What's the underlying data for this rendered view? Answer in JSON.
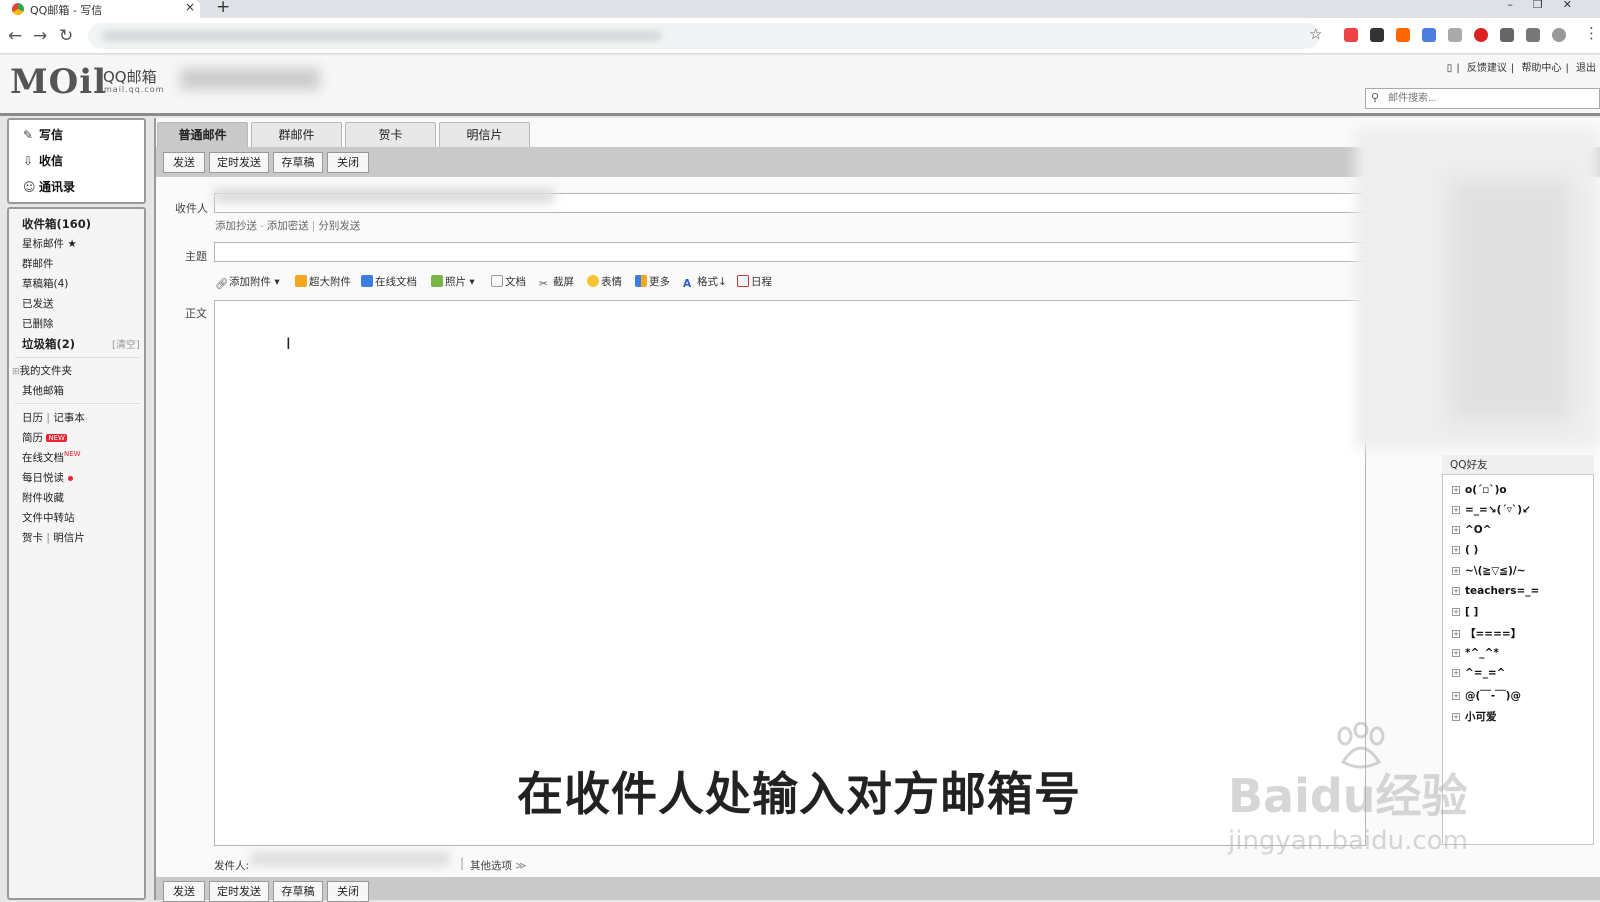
{
  "browser": {
    "tab_title": "QQ邮箱 - 写信",
    "tab_close": "×",
    "new_tab": "+",
    "window_controls": "–❐✕"
  },
  "header": {
    "logo_mail": "MOil",
    "logo_qq": "QQ邮箱",
    "logo_domain": "mail.qq.com",
    "links": [
      "反馈建议",
      "帮助中心",
      "退出"
    ],
    "search_placeholder": "邮件搜索..."
  },
  "nav_top": [
    {
      "label": "写信",
      "icon": "pen-icon"
    },
    {
      "label": "收信",
      "icon": "inbox-icon"
    },
    {
      "label": "通讯录",
      "icon": "contacts-icon"
    }
  ],
  "nav": {
    "inbox": "收件箱(160)",
    "starred": "星标邮件",
    "group": "群邮件",
    "drafts": "草稿箱(4)",
    "sent": "已发送",
    "deleted": "已删除",
    "spam": "垃圾箱(2)",
    "spam_clear": "[清空]",
    "my_folders": "我的文件夹",
    "other_mailbox": "其他邮箱",
    "calendar": "日历",
    "notes": "记事本",
    "resume": "简历",
    "resume_badge": "NEW",
    "online_docs": "在线文档",
    "online_docs_badge": "NEW",
    "daily_read": "每日悦读",
    "attachments": "附件收藏",
    "file_transfer": "文件中转站",
    "cards": "贺卡",
    "postcards": "明信片",
    "divider": "|"
  },
  "compose": {
    "tabs": [
      "普通邮件",
      "群邮件",
      "贺卡",
      "明信片"
    ],
    "actions": [
      "发送",
      "定时发送",
      "存草稿",
      "关闭"
    ],
    "to_label": "收件人",
    "cc_links": [
      "添加抄送",
      "添加密送",
      "分别发送"
    ],
    "cc_sep": "-",
    "cc_sep2": "|",
    "subject_label": "主题",
    "body_label": "正文",
    "toolbar": [
      "添加附件",
      "超大附件",
      "在线文档",
      "照片",
      "文档",
      "截屏",
      "表情",
      "更多",
      "格式",
      "日程"
    ],
    "sender_label": "发件人:",
    "other_options": "其他选项"
  },
  "qq_friends": {
    "title": "QQ好友",
    "groups": [
      "o(´▫`)o",
      "=_=↘(´▿`)↙",
      "^O^",
      "( )",
      "~\\(≧▽≦)/~",
      "teachers=_=",
      "[ ]",
      "【====】",
      "*^_^*",
      "^=_=^",
      "@(￣-￣)@",
      "小可爱"
    ]
  },
  "overlay": {
    "subtitle": "在收件人处输入对方邮箱号",
    "watermark": "Baidu经验",
    "watermark_url": "jingyan.baidu.com"
  }
}
